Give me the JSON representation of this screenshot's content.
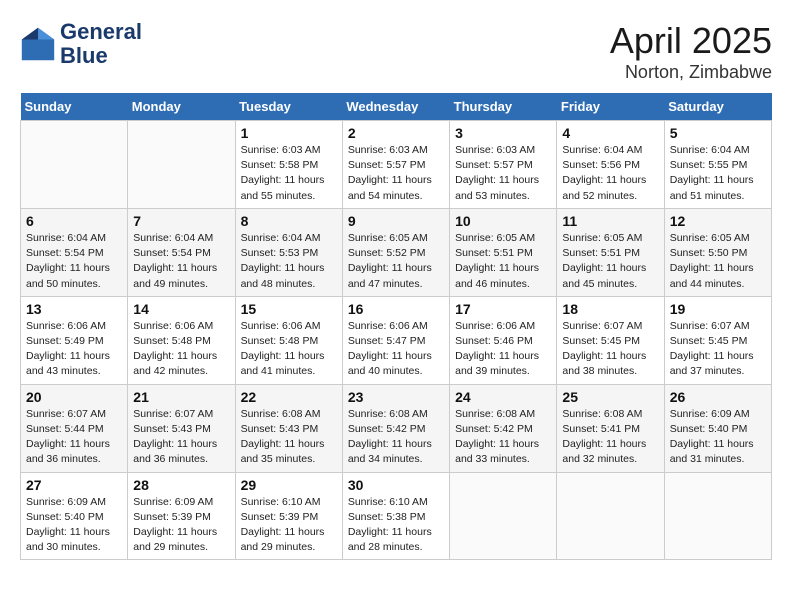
{
  "logo": {
    "line1": "General",
    "line2": "Blue"
  },
  "title": "April 2025",
  "subtitle": "Norton, Zimbabwe",
  "days_of_week": [
    "Sunday",
    "Monday",
    "Tuesday",
    "Wednesday",
    "Thursday",
    "Friday",
    "Saturday"
  ],
  "weeks": [
    [
      {
        "day": "",
        "sunrise": "",
        "sunset": "",
        "daylight": ""
      },
      {
        "day": "",
        "sunrise": "",
        "sunset": "",
        "daylight": ""
      },
      {
        "day": "1",
        "sunrise": "Sunrise: 6:03 AM",
        "sunset": "Sunset: 5:58 PM",
        "daylight": "Daylight: 11 hours and 55 minutes."
      },
      {
        "day": "2",
        "sunrise": "Sunrise: 6:03 AM",
        "sunset": "Sunset: 5:57 PM",
        "daylight": "Daylight: 11 hours and 54 minutes."
      },
      {
        "day": "3",
        "sunrise": "Sunrise: 6:03 AM",
        "sunset": "Sunset: 5:57 PM",
        "daylight": "Daylight: 11 hours and 53 minutes."
      },
      {
        "day": "4",
        "sunrise": "Sunrise: 6:04 AM",
        "sunset": "Sunset: 5:56 PM",
        "daylight": "Daylight: 11 hours and 52 minutes."
      },
      {
        "day": "5",
        "sunrise": "Sunrise: 6:04 AM",
        "sunset": "Sunset: 5:55 PM",
        "daylight": "Daylight: 11 hours and 51 minutes."
      }
    ],
    [
      {
        "day": "6",
        "sunrise": "Sunrise: 6:04 AM",
        "sunset": "Sunset: 5:54 PM",
        "daylight": "Daylight: 11 hours and 50 minutes."
      },
      {
        "day": "7",
        "sunrise": "Sunrise: 6:04 AM",
        "sunset": "Sunset: 5:54 PM",
        "daylight": "Daylight: 11 hours and 49 minutes."
      },
      {
        "day": "8",
        "sunrise": "Sunrise: 6:04 AM",
        "sunset": "Sunset: 5:53 PM",
        "daylight": "Daylight: 11 hours and 48 minutes."
      },
      {
        "day": "9",
        "sunrise": "Sunrise: 6:05 AM",
        "sunset": "Sunset: 5:52 PM",
        "daylight": "Daylight: 11 hours and 47 minutes."
      },
      {
        "day": "10",
        "sunrise": "Sunrise: 6:05 AM",
        "sunset": "Sunset: 5:51 PM",
        "daylight": "Daylight: 11 hours and 46 minutes."
      },
      {
        "day": "11",
        "sunrise": "Sunrise: 6:05 AM",
        "sunset": "Sunset: 5:51 PM",
        "daylight": "Daylight: 11 hours and 45 minutes."
      },
      {
        "day": "12",
        "sunrise": "Sunrise: 6:05 AM",
        "sunset": "Sunset: 5:50 PM",
        "daylight": "Daylight: 11 hours and 44 minutes."
      }
    ],
    [
      {
        "day": "13",
        "sunrise": "Sunrise: 6:06 AM",
        "sunset": "Sunset: 5:49 PM",
        "daylight": "Daylight: 11 hours and 43 minutes."
      },
      {
        "day": "14",
        "sunrise": "Sunrise: 6:06 AM",
        "sunset": "Sunset: 5:48 PM",
        "daylight": "Daylight: 11 hours and 42 minutes."
      },
      {
        "day": "15",
        "sunrise": "Sunrise: 6:06 AM",
        "sunset": "Sunset: 5:48 PM",
        "daylight": "Daylight: 11 hours and 41 minutes."
      },
      {
        "day": "16",
        "sunrise": "Sunrise: 6:06 AM",
        "sunset": "Sunset: 5:47 PM",
        "daylight": "Daylight: 11 hours and 40 minutes."
      },
      {
        "day": "17",
        "sunrise": "Sunrise: 6:06 AM",
        "sunset": "Sunset: 5:46 PM",
        "daylight": "Daylight: 11 hours and 39 minutes."
      },
      {
        "day": "18",
        "sunrise": "Sunrise: 6:07 AM",
        "sunset": "Sunset: 5:45 PM",
        "daylight": "Daylight: 11 hours and 38 minutes."
      },
      {
        "day": "19",
        "sunrise": "Sunrise: 6:07 AM",
        "sunset": "Sunset: 5:45 PM",
        "daylight": "Daylight: 11 hours and 37 minutes."
      }
    ],
    [
      {
        "day": "20",
        "sunrise": "Sunrise: 6:07 AM",
        "sunset": "Sunset: 5:44 PM",
        "daylight": "Daylight: 11 hours and 36 minutes."
      },
      {
        "day": "21",
        "sunrise": "Sunrise: 6:07 AM",
        "sunset": "Sunset: 5:43 PM",
        "daylight": "Daylight: 11 hours and 36 minutes."
      },
      {
        "day": "22",
        "sunrise": "Sunrise: 6:08 AM",
        "sunset": "Sunset: 5:43 PM",
        "daylight": "Daylight: 11 hours and 35 minutes."
      },
      {
        "day": "23",
        "sunrise": "Sunrise: 6:08 AM",
        "sunset": "Sunset: 5:42 PM",
        "daylight": "Daylight: 11 hours and 34 minutes."
      },
      {
        "day": "24",
        "sunrise": "Sunrise: 6:08 AM",
        "sunset": "Sunset: 5:42 PM",
        "daylight": "Daylight: 11 hours and 33 minutes."
      },
      {
        "day": "25",
        "sunrise": "Sunrise: 6:08 AM",
        "sunset": "Sunset: 5:41 PM",
        "daylight": "Daylight: 11 hours and 32 minutes."
      },
      {
        "day": "26",
        "sunrise": "Sunrise: 6:09 AM",
        "sunset": "Sunset: 5:40 PM",
        "daylight": "Daylight: 11 hours and 31 minutes."
      }
    ],
    [
      {
        "day": "27",
        "sunrise": "Sunrise: 6:09 AM",
        "sunset": "Sunset: 5:40 PM",
        "daylight": "Daylight: 11 hours and 30 minutes."
      },
      {
        "day": "28",
        "sunrise": "Sunrise: 6:09 AM",
        "sunset": "Sunset: 5:39 PM",
        "daylight": "Daylight: 11 hours and 29 minutes."
      },
      {
        "day": "29",
        "sunrise": "Sunrise: 6:10 AM",
        "sunset": "Sunset: 5:39 PM",
        "daylight": "Daylight: 11 hours and 29 minutes."
      },
      {
        "day": "30",
        "sunrise": "Sunrise: 6:10 AM",
        "sunset": "Sunset: 5:38 PM",
        "daylight": "Daylight: 11 hours and 28 minutes."
      },
      {
        "day": "",
        "sunrise": "",
        "sunset": "",
        "daylight": ""
      },
      {
        "day": "",
        "sunrise": "",
        "sunset": "",
        "daylight": ""
      },
      {
        "day": "",
        "sunrise": "",
        "sunset": "",
        "daylight": ""
      }
    ]
  ]
}
